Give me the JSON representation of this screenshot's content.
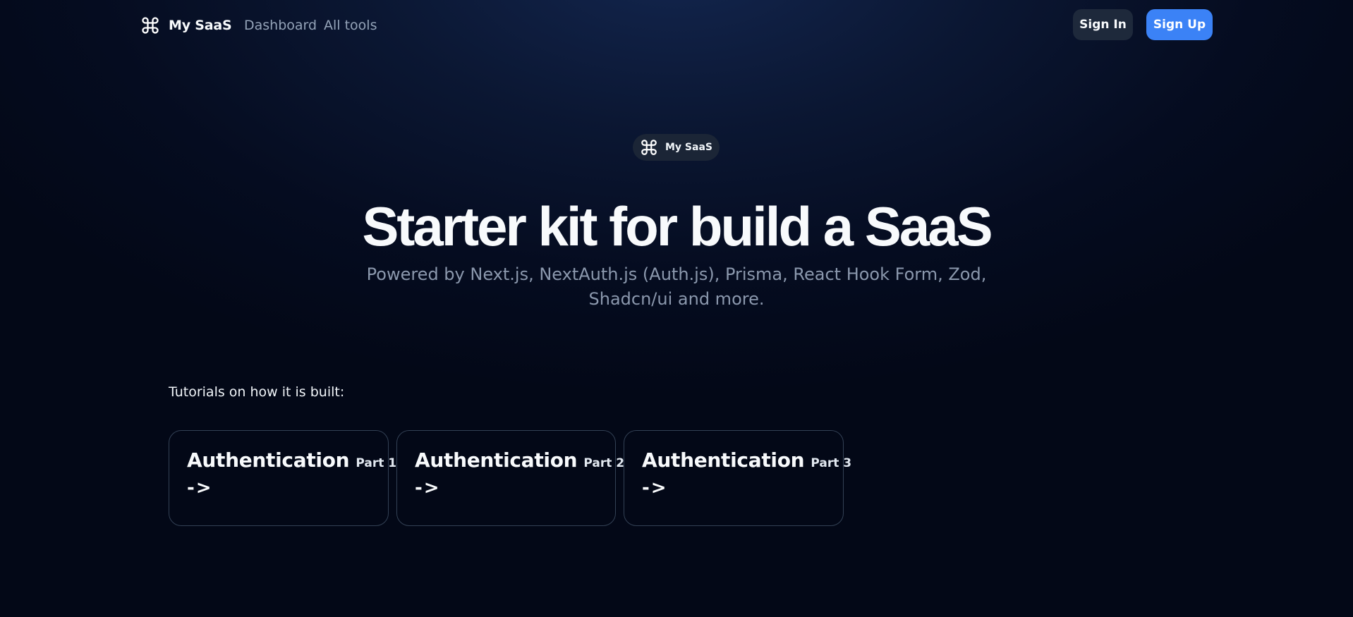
{
  "navbar": {
    "brand_icon": "command-icon",
    "brand_name": "My SaaS",
    "links": [
      {
        "label": "Dashboard"
      },
      {
        "label": "All tools"
      }
    ],
    "sign_in_label": "Sign In",
    "sign_up_label": "Sign Up"
  },
  "hero": {
    "badge_icon": "command-icon",
    "badge_text": "My SaaS",
    "title": "Starter kit for build a SaaS",
    "subtitle": "Powered by Next.js, NextAuth.js (Auth.js), Prisma, React Hook Form, Zod, Shadcn/ui and more."
  },
  "tutorials": {
    "heading": "Tutorials on how it is built:",
    "cards": [
      {
        "title": "Authentication",
        "part": "Part 1",
        "arrow": "->"
      },
      {
        "title": "Authentication",
        "part": "Part 2",
        "arrow": "->"
      },
      {
        "title": "Authentication",
        "part": "Part 3",
        "arrow": "->"
      }
    ]
  },
  "colors": {
    "background": "#030817",
    "accent": "#3b82f6",
    "muted_text": "#94a3b8",
    "card_border": "#334155"
  }
}
